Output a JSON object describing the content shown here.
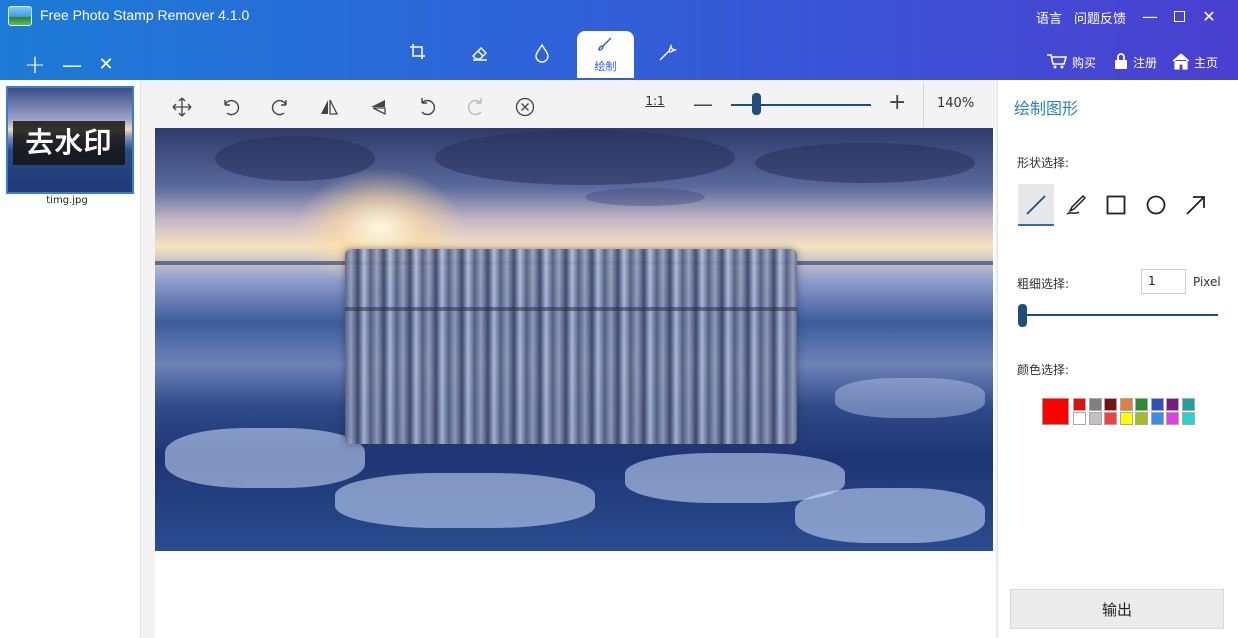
{
  "titlebar": {
    "title": "Free Photo Stamp Remover 4.1.0",
    "language": "语言",
    "feedback": "问题反馈",
    "minimize": "—",
    "close": "✕"
  },
  "file_actions": {
    "add": "+",
    "remove": "—",
    "clear": "✕"
  },
  "tool_tabs": [
    {
      "name": "crop",
      "icon": "crop-icon",
      "label": ""
    },
    {
      "name": "eraser",
      "icon": "eraser-icon",
      "label": ""
    },
    {
      "name": "drop",
      "icon": "drop-icon",
      "label": ""
    },
    {
      "name": "draw",
      "icon": "brush-icon",
      "label": "绘制"
    },
    {
      "name": "magic",
      "icon": "magic-wand-icon",
      "label": ""
    }
  ],
  "top_links": {
    "buy": "购买",
    "register": "注册",
    "home": "主页"
  },
  "thumbnails": [
    {
      "file_name": "timg.jpg",
      "watermark_text": "去水印"
    }
  ],
  "toolbar": {
    "ratio": "1:1",
    "zoom_minus": "—",
    "zoom_plus": "+",
    "zoom_level": "140%",
    "zoom_fraction": 0.15
  },
  "right_panel": {
    "title": "绘制图形",
    "shape_label": "形状选择:",
    "shapes": [
      "line-icon",
      "pen-icon",
      "rectangle-icon",
      "circle-icon",
      "arrow-icon"
    ],
    "thickness_label": "粗细选择:",
    "thickness_value": "1",
    "thickness_unit": "Pixel",
    "thickness_fraction": 0.0,
    "color_label": "颜色选择:",
    "current_color": "#ff0000",
    "palette_row1": [
      "#e01010",
      "#808080",
      "#7a1010",
      "#e08040",
      "#2e8b2e",
      "#3050c0",
      "#7a1a8a",
      "#20a0a0"
    ],
    "palette_row2": [
      "#ffffff",
      "#c0c0c0",
      "#f04040",
      "#ffff00",
      "#a0c020",
      "#3a90e0",
      "#e040e0",
      "#30d0d0"
    ],
    "output": "输出"
  }
}
